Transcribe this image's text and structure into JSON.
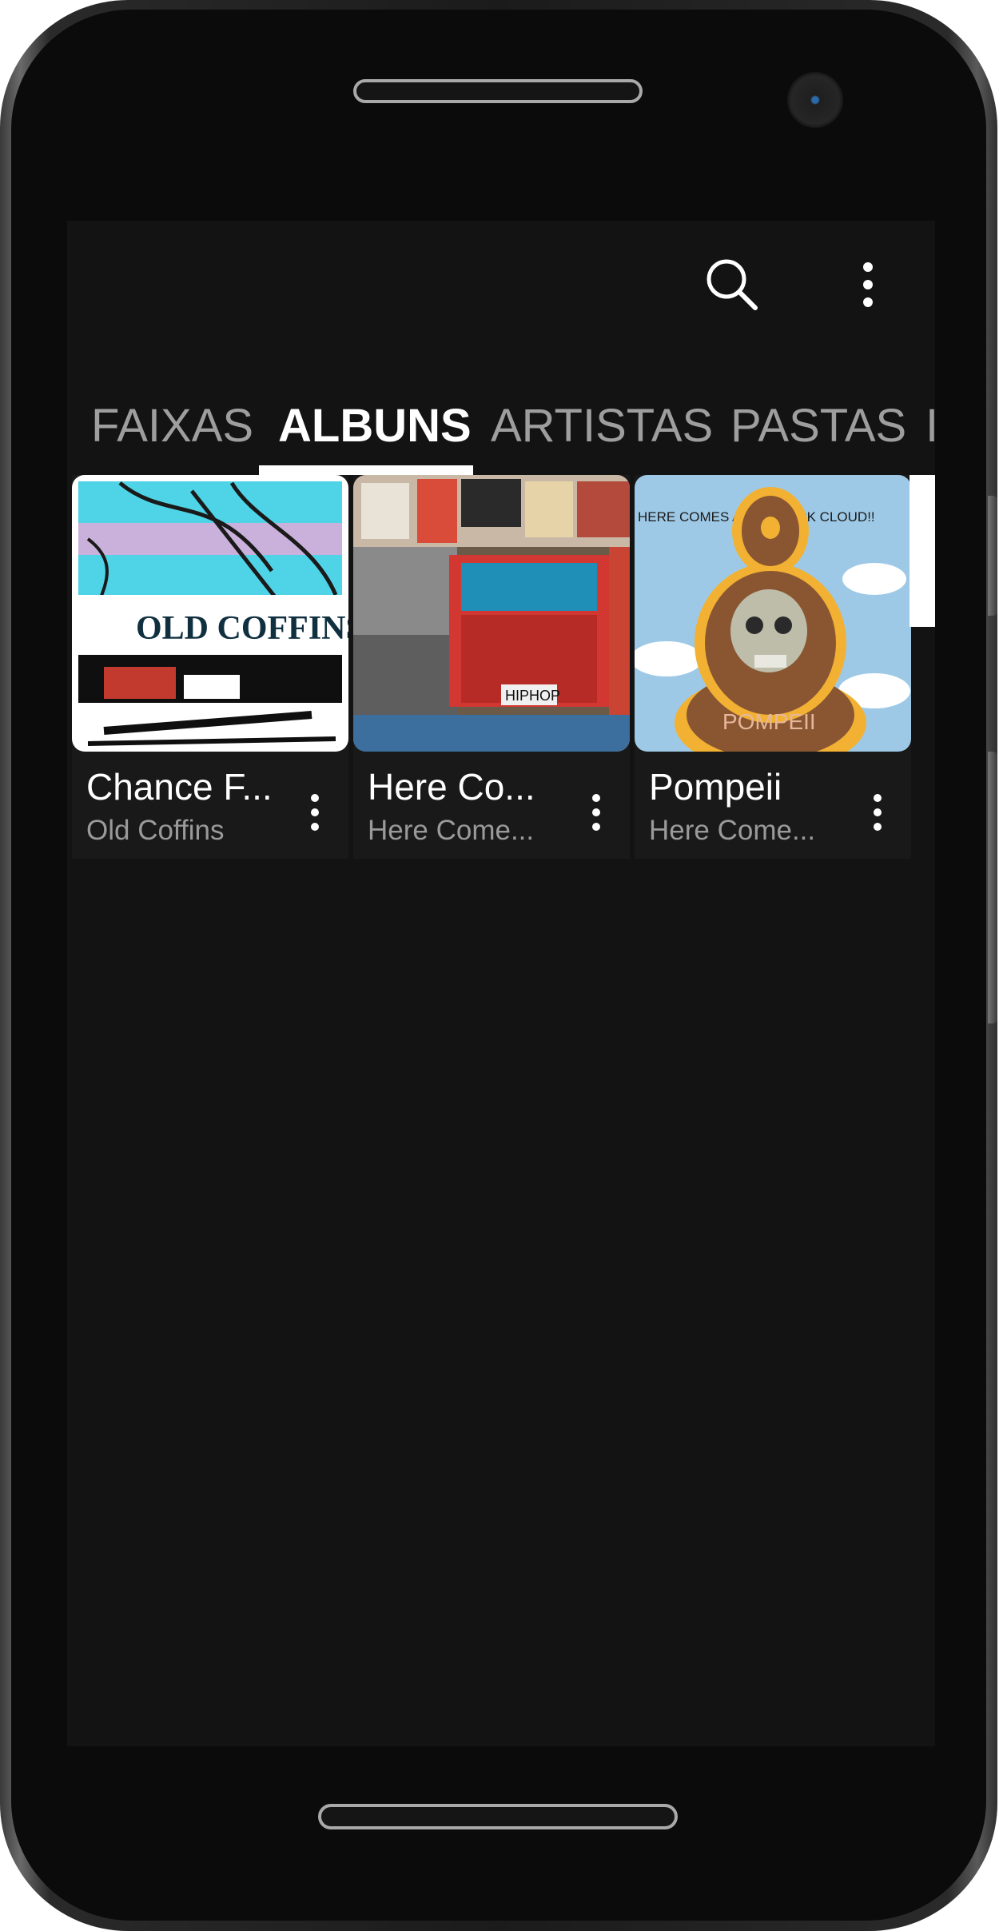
{
  "app_bar": {
    "search_icon": "search-icon",
    "more_icon": "more-vertical-icon"
  },
  "tabs": [
    {
      "label": "FAIXAS",
      "active": false
    },
    {
      "label": "ALBUNS",
      "active": true
    },
    {
      "label": "ARTISTAS",
      "active": false
    },
    {
      "label": "PASTAS",
      "active": false
    },
    {
      "label": "I",
      "active": false
    }
  ],
  "albums": [
    {
      "title": "Chance F...",
      "subtitle": "Old Coffins",
      "art_text": "OLD COFFINS"
    },
    {
      "title": "Here Co...",
      "subtitle": "Here Come...",
      "art_text": "HIPHOP"
    },
    {
      "title": "Pompeii",
      "subtitle": "Here Come...",
      "art_text": "POMPEII",
      "art_caption": "HERE COMES A BIG BLACK CLOUD!!"
    }
  ],
  "colors": {
    "screen_bg": "#131313",
    "card_bg": "#191919",
    "tab_active": "#ffffff",
    "tab_inactive": "#9e9e9e"
  }
}
